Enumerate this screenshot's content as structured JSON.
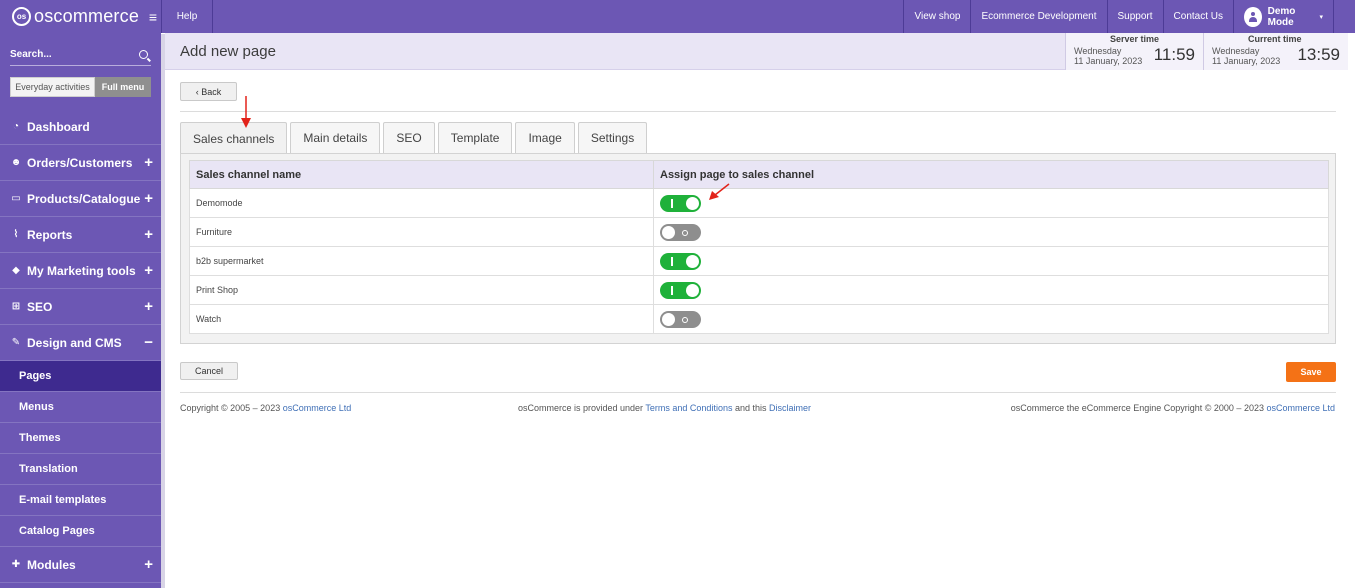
{
  "sidebar": {
    "logo_text": "oscommerce",
    "logo_mark": "os",
    "search_placeholder": "Search...",
    "mode_everyday": "Everyday activities",
    "mode_full": "Full menu",
    "items": [
      {
        "label": "Dashboard",
        "icon": "dashboard-icon",
        "glyph": "◔",
        "expand": ""
      },
      {
        "label": "Orders/Customers",
        "icon": "users-icon",
        "glyph": "☻",
        "expand": "+"
      },
      {
        "label": "Products/Catalogue",
        "icon": "folder-icon",
        "glyph": "▭",
        "expand": "+"
      },
      {
        "label": "Reports",
        "icon": "chart-icon",
        "glyph": "⌇",
        "expand": "+"
      },
      {
        "label": "My Marketing tools",
        "icon": "tag-icon",
        "glyph": "◆",
        "expand": "+"
      },
      {
        "label": "SEO",
        "icon": "sitemap-icon",
        "glyph": "⊞",
        "expand": "+"
      },
      {
        "label": "Design and CMS",
        "icon": "brush-icon",
        "glyph": "✎",
        "expand": "−"
      }
    ],
    "sub_items": [
      "Pages",
      "Menus",
      "Themes",
      "Translation",
      "E-mail templates",
      "Catalog Pages"
    ],
    "modules": {
      "label": "Modules",
      "icon": "puzzle-icon",
      "glyph": "✚",
      "expand": "+"
    }
  },
  "topbar": {
    "help": "Help",
    "links": [
      "View shop",
      "Ecommerce Development",
      "Support",
      "Contact Us"
    ],
    "user": "Demo Mode",
    "caret": "▾"
  },
  "header": {
    "title": "Add new page",
    "server_label": "Server time",
    "server_day": "Wednesday",
    "server_date": "11 January, 2023",
    "server_time": "11:59",
    "current_label": "Current time",
    "current_day": "Wednesday",
    "current_date": "11 January, 2023",
    "current_time": "13:59"
  },
  "back_label": "‹ Back",
  "tabs": [
    "Sales channels",
    "Main details",
    "SEO",
    "Template",
    "Image",
    "Settings"
  ],
  "table": {
    "col_name": "Sales channel name",
    "col_assign": "Assign page to sales channel",
    "rows": [
      {
        "name": "Demomode",
        "on": true
      },
      {
        "name": "Furniture",
        "on": false
      },
      {
        "name": "b2b supermarket",
        "on": true
      },
      {
        "name": "Print Shop",
        "on": true
      },
      {
        "name": "Watch",
        "on": false
      }
    ]
  },
  "cancel_label": "Cancel",
  "save_label": "Save",
  "footer": {
    "left_text": "Copyright © 2005 – 2023 ",
    "left_link": "osCommerce Ltd",
    "mid_text1": "osCommerce is provided under ",
    "mid_link1": "Terms and Conditions",
    "mid_text2": " and this ",
    "mid_link2": "Disclaimer",
    "right_text": "osCommerce the eCommerce Engine Copyright © 2000 – 2023 ",
    "right_link": "osCommerce Ltd"
  },
  "colors": {
    "brand": "#6c57b4",
    "active_sub": "#3e2a8f",
    "switch_on": "#1fb13a",
    "save": "#f47216",
    "annotation": "#e2231a"
  }
}
